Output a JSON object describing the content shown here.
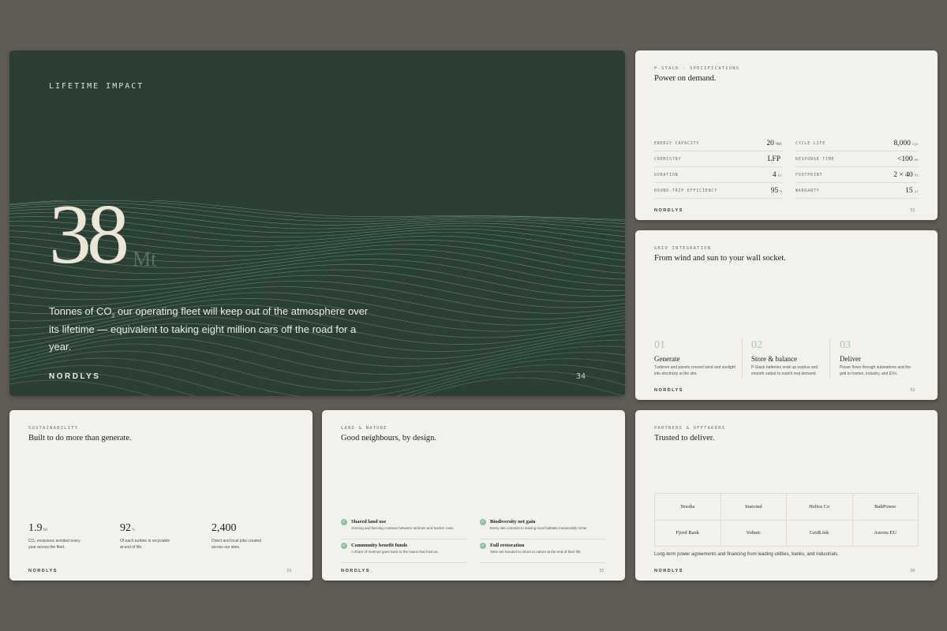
{
  "hero": {
    "eyebrow": "LIFETIME IMPACT",
    "number": "38",
    "unit": "Mt",
    "desc_pre": "Tonnes of CO",
    "desc_sub": "2",
    "desc_post": " our operating fleet will keep out of the atmosphere over its lifetime — equivalent to taking eight million cars off the road for a year.",
    "brand": "NORDLYS",
    "page": "34",
    "colors": {
      "background": "#2b3e33",
      "accent": "#52765f",
      "wave": "#7fb091"
    }
  },
  "specs": {
    "eyebrow": "P-STACK · SPECIFICATIONS",
    "title": "Power on demand.",
    "left": [
      {
        "label": "ENERGY CAPACITY",
        "value": "20",
        "unit": "MWh"
      },
      {
        "label": "CHEMISTRY",
        "value": "LFP",
        "unit": ""
      },
      {
        "label": "DURATION",
        "value": "4",
        "unit": "hr"
      },
      {
        "label": "ROUND-TRIP EFFICIENCY",
        "value": "95",
        "unit": "%"
      }
    ],
    "right": [
      {
        "label": "CYCLE LIFE",
        "value": "8,000",
        "unit": "cyc"
      },
      {
        "label": "RESPONSE TIME",
        "value": "<100",
        "unit": "ms"
      },
      {
        "label": "FOOTPRINT",
        "value": "2 × 40",
        "unit": "ft"
      },
      {
        "label": "WARRANTY",
        "value": "15",
        "unit": "yr"
      }
    ],
    "brand": "NORDLYS",
    "page": "31"
  },
  "grid": {
    "eyebrow": "GRID INTEGRATION",
    "title": "From wind and sun to your wall socket.",
    "steps": [
      {
        "num": "01",
        "title": "Generate",
        "desc1": "Turbines and panels convert wind and sunlight",
        "desc2": "into electricity at the site."
      },
      {
        "num": "02",
        "title": "Store & balance",
        "desc1": "P-Stack batteries soak up surplus and",
        "desc2": "smooth output to match real demand."
      },
      {
        "num": "03",
        "title": "Deliver",
        "desc1": "Power flows through substations and the",
        "desc2": "grid to homes, industry, and EVs."
      }
    ],
    "brand": "NORDLYS",
    "page": "32"
  },
  "sust": {
    "eyebrow": "SUSTAINABILITY",
    "title": "Built to do more than generate.",
    "stats": [
      {
        "value": "1.9",
        "unit": "Mt",
        "desc1": "CO₂ emissions avoided every",
        "desc2": "year across the fleet."
      },
      {
        "value": "92",
        "unit": "%",
        "desc1": "Of each turbine is recyclable",
        "desc2": "at end of life."
      },
      {
        "value": "2,400",
        "unit": "",
        "desc1": "Direct and local jobs created",
        "desc2": "across our sites."
      }
    ],
    "brand": "NORDLYS",
    "page": "33"
  },
  "land": {
    "eyebrow": "LAND & NATURE",
    "title": "Good neighbours, by design.",
    "features": [
      {
        "title": "Shared land use",
        "desc": "Grazing and farming continue between turbines and tracker rows."
      },
      {
        "title": "Biodiversity net gain",
        "desc": "Every site commits to leaving local habitats measurably richer."
      },
      {
        "title": "Community benefit funds",
        "desc": "A share of revenue goes back to the towns that host us."
      },
      {
        "title": "Full restoration",
        "desc": "Sites are bonded to return to nature at the end of their life."
      }
    ],
    "brand": "NORDLYS",
    "page": "35"
  },
  "partners": {
    "eyebrow": "PARTNERS & OFFTAKERS",
    "title": "Trusted to deliver.",
    "names": [
      "Nordia",
      "Statvind",
      "Helios Co",
      "BaltPower",
      "Fjord Bank",
      "Voltaic",
      "GridLink",
      "Aurora EU"
    ],
    "footer": "Long-term power agreements and financing from leading utilities, banks, and industrials.",
    "brand": "NORDLYS",
    "page": "36"
  }
}
